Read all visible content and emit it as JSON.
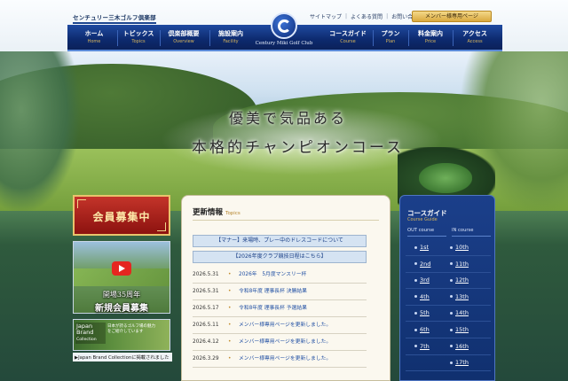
{
  "header": {
    "logo_text": "センチュリー三木ゴルフ倶楽部",
    "util_links": [
      "サイトマップ",
      "よくある質問",
      "お問い合わせ"
    ],
    "member_button": "メンバー様専用ページ",
    "center_logo": "Century Miki Golf Club",
    "nav": [
      {
        "jp": "ホーム",
        "en": "Home"
      },
      {
        "jp": "トピックス",
        "en": "Topics"
      },
      {
        "jp": "倶楽部概要",
        "en": "Overview"
      },
      {
        "jp": "施設案内",
        "en": "Facility"
      },
      {
        "jp": "コースガイド",
        "en": "Course"
      },
      {
        "jp": "プラン",
        "en": "Plan"
      },
      {
        "jp": "料金案内",
        "en": "Price"
      },
      {
        "jp": "アクセス",
        "en": "Access"
      }
    ]
  },
  "hero": {
    "catch_line1": "優美で気品ある",
    "catch_line2": "本格的チャンピオンコース"
  },
  "left": {
    "recruit_label": "会員募集中",
    "video_caption_line1": "開場35周年",
    "video_caption_line2": "新規会員募集",
    "jbc_title": "Japan Brand",
    "jbc_sub": "Collection",
    "jbc_desc": "日本が誇るゴルフ場の魅力をご紹介しています",
    "jbc_caption": "▶Japan Brand Collectionに掲載されました"
  },
  "topics": {
    "heading": "更新情報",
    "heading_en": "Topics",
    "notices": [
      "【マナー】来場時、プレー中のドレスコードについて",
      "【2026年度クラブ競技日程はこちら】"
    ],
    "news": [
      {
        "date": "2026.5.31",
        "bullet": "•",
        "title": "2026年　5月度マンスリー杯"
      },
      {
        "date": "2026.5.31",
        "bullet": "•",
        "title": "令和8年度 理事長杯 決勝結果"
      },
      {
        "date": "2026.5.17",
        "bullet": "•",
        "title": "令和8年度 理事長杯 予選結果"
      },
      {
        "date": "2026.5.11",
        "bullet": "•",
        "title": "メンバー様専用ページを更新しました。"
      },
      {
        "date": "2026.4.12",
        "bullet": "•",
        "title": "メンバー様専用ページを更新しました。"
      },
      {
        "date": "2026.3.29",
        "bullet": "•",
        "title": "メンバー様専用ページを更新しました。"
      }
    ]
  },
  "guide": {
    "title": "コースガイド",
    "subtitle": "Course Guide",
    "out_label": "OUT course",
    "in_label": "IN course",
    "out_holes": [
      "1st",
      "2nd",
      "3rd",
      "4th",
      "5th",
      "6th",
      "7th"
    ],
    "in_holes": [
      "10th",
      "11th",
      "12th",
      "13th",
      "14th",
      "15th",
      "16th",
      "17th"
    ]
  }
}
